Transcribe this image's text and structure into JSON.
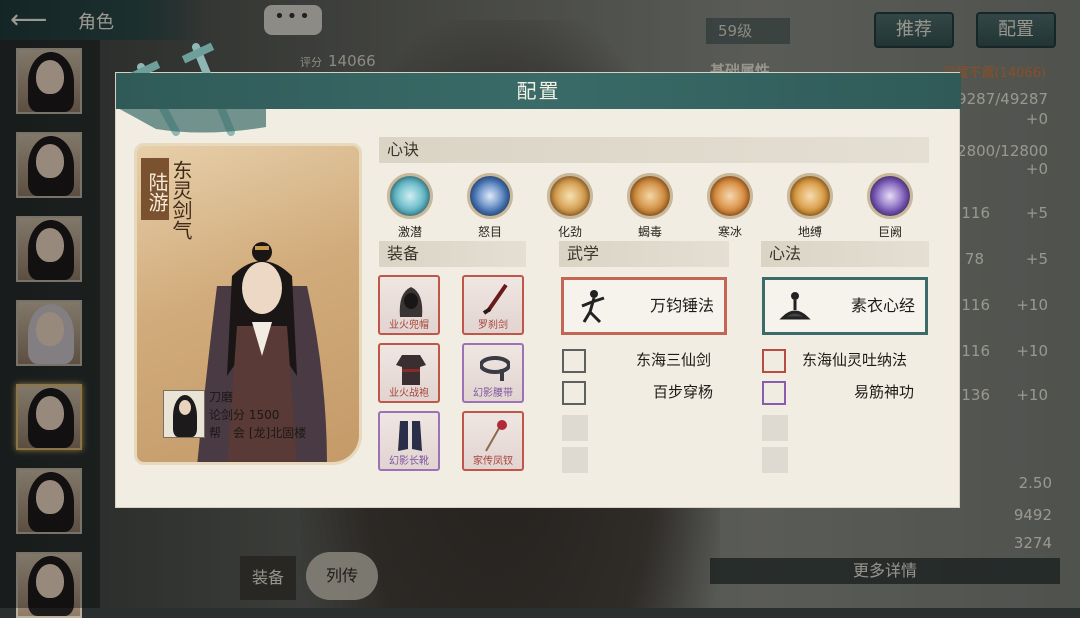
{
  "header": {
    "back_icon": "back-arrow-icon",
    "title": "角色"
  },
  "chat_button": {
    "label": "•••"
  },
  "background": {
    "level": "59级",
    "recommend_label": "推荐",
    "config_label": "配置",
    "score_label": "评分",
    "score_value": "14066",
    "attr_heading": "基础属性",
    "attr_rank": "深藏不露(14066)",
    "values": [
      "49287/49287",
      "+0",
      "12800/12800",
      "+0",
      "116",
      "+5",
      "78",
      "+5",
      "116",
      "+10",
      "116",
      "+10",
      "136",
      "+10",
      "2.50",
      "9492",
      "3274"
    ],
    "more_details": "更多详情",
    "bottom_tab_1": "装备",
    "bottom_tab_2": "列传"
  },
  "modal": {
    "title": "配置",
    "character": {
      "name": "陆游",
      "title": "东灵剑气",
      "guild_player": "刀磨",
      "score_label": "论剑分",
      "score": "1500",
      "guild_label": "帮　会",
      "guild": "[龙]北固楼"
    },
    "sections": {
      "xinjue": "心诀",
      "equipment": "装备",
      "martial": "武学",
      "xinfa": "心法"
    },
    "xinjue_items": [
      {
        "label": "激潜",
        "icon": "vortex-icon",
        "color": "#5fb6c4"
      },
      {
        "label": "怒目",
        "icon": "eye-icon",
        "color": "#4a78b8"
      },
      {
        "label": "化劲",
        "icon": "swirl-flame-icon",
        "color": "#d39a4a"
      },
      {
        "label": "蝎毒",
        "icon": "scorpion-icon",
        "color": "#d08a3c"
      },
      {
        "label": "寒冰",
        "icon": "snowflake-icon",
        "color": "#d88a3c"
      },
      {
        "label": "地缚",
        "icon": "spiral-icon",
        "color": "#d8983e"
      },
      {
        "label": "巨阙",
        "icon": "gate-icon",
        "color": "#7a5ab8"
      }
    ],
    "equipment": [
      {
        "label": "业火兜帽",
        "icon": "hood-icon",
        "quality": "red"
      },
      {
        "label": "罗刹剑",
        "icon": "sword-icon",
        "quality": "red"
      },
      {
        "label": "业火战袍",
        "icon": "robe-icon",
        "quality": "red"
      },
      {
        "label": "幻影腰带",
        "icon": "belt-icon",
        "quality": "purple"
      },
      {
        "label": "幻影长靴",
        "icon": "boots-icon",
        "quality": "purple"
      },
      {
        "label": "家传凤钗",
        "icon": "hairpin-icon",
        "quality": "red"
      }
    ],
    "martial": {
      "main": "万钧锤法",
      "minor": [
        "东海三仙剑",
        "百步穿杨"
      ]
    },
    "xinfa": {
      "main": "素衣心经",
      "minor": [
        "东海仙灵吐纳法",
        "易筋神功"
      ]
    }
  }
}
